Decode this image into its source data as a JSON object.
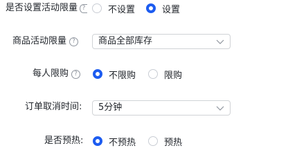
{
  "form": {
    "activity_limit": {
      "label": "是否设置活动限量",
      "options": [
        "不设置",
        "设置"
      ],
      "selected": "设置"
    },
    "product_activity_limit": {
      "label": "商品活动限量",
      "value": "商品全部库存"
    },
    "per_person_limit": {
      "label": "每人限购",
      "options": [
        "不限购",
        "限购"
      ],
      "selected": "不限购"
    },
    "order_cancel_time": {
      "label": "订单取消时间:",
      "value": "5分钟"
    },
    "preheat": {
      "label": "是否预热:",
      "options": [
        "不预热",
        "预热"
      ],
      "selected": "不预热"
    }
  },
  "icons": {
    "help": "question-circle-icon",
    "dropdown": "chevron-down-icon"
  },
  "colors": {
    "accent": "#1d5cf0",
    "border": "#d0d3d6",
    "text": "#1f2329",
    "muted": "#8f959e"
  }
}
